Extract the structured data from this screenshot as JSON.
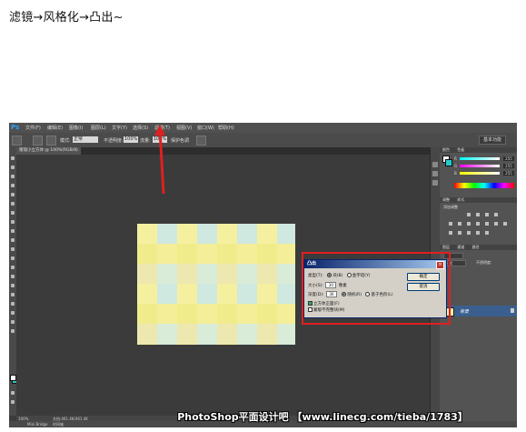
{
  "caption": "滤镜→风格化→凸出~",
  "photoshop": {
    "logo": "Ps",
    "menu": [
      "文件(F)",
      "编辑(E)",
      "图像(I)",
      "图层(L)",
      "文字(Y)",
      "选择(S)",
      "滤镜(T)",
      "视图(V)",
      "窗口(W)",
      "帮助(H)"
    ],
    "options": {
      "mode_label": "模式:",
      "mode_value": "正常",
      "opacity_label": "不透明度:",
      "opacity_value": "100%",
      "flow_label": "流量:",
      "flow_value": "100%",
      "protect_label": "保护色调",
      "workspace": "基本功能"
    },
    "document_tab": "猪瑙小立方体 @ 100%(RGB/8)",
    "status": {
      "zoom": "100%",
      "doc_info": "文档:461.4K/461.4K",
      "minibridge": "Mini Bridge",
      "timeline": "时间轴"
    },
    "right_panels": {
      "color_tabs": [
        "颜色",
        "色板"
      ],
      "color_channels": [
        {
          "label": "R",
          "value": "255"
        },
        {
          "label": "G",
          "value": "255"
        },
        {
          "label": "B",
          "value": "255"
        }
      ],
      "adjust_tabs": [
        "调整",
        "样式"
      ],
      "adjust_title": "添加调整",
      "layers_tabs": [
        "图层",
        "通道",
        "路径"
      ],
      "layer_blend": "正常",
      "layer_opacity": "不透明度:",
      "layer_name": "背景"
    },
    "dialog": {
      "title": "凸出",
      "type_label": "类型(T):",
      "type_options": [
        "块(B)",
        "金字塔(Y)"
      ],
      "size_label": "大小(S):",
      "size_value": "30",
      "size_unit": "像素",
      "depth_label": "深度(D):",
      "depth_value": "30",
      "depth_options": [
        "随机(R)",
        "基于色阶(L)"
      ],
      "check_front": "立方体正面(F)",
      "check_mask": "蒙版不完整块(M)",
      "ok_label": "确定",
      "cancel_label": "取消"
    },
    "checker_colors": [
      "#f5f0a0",
      "#d8ecd8",
      "#f0ec8c",
      "#cfe8e0",
      "#ece8b0",
      "#f4ee98"
    ]
  },
  "watermark": "PhotoShop平面设计吧 【www.linecg.com/tieba/1783】"
}
